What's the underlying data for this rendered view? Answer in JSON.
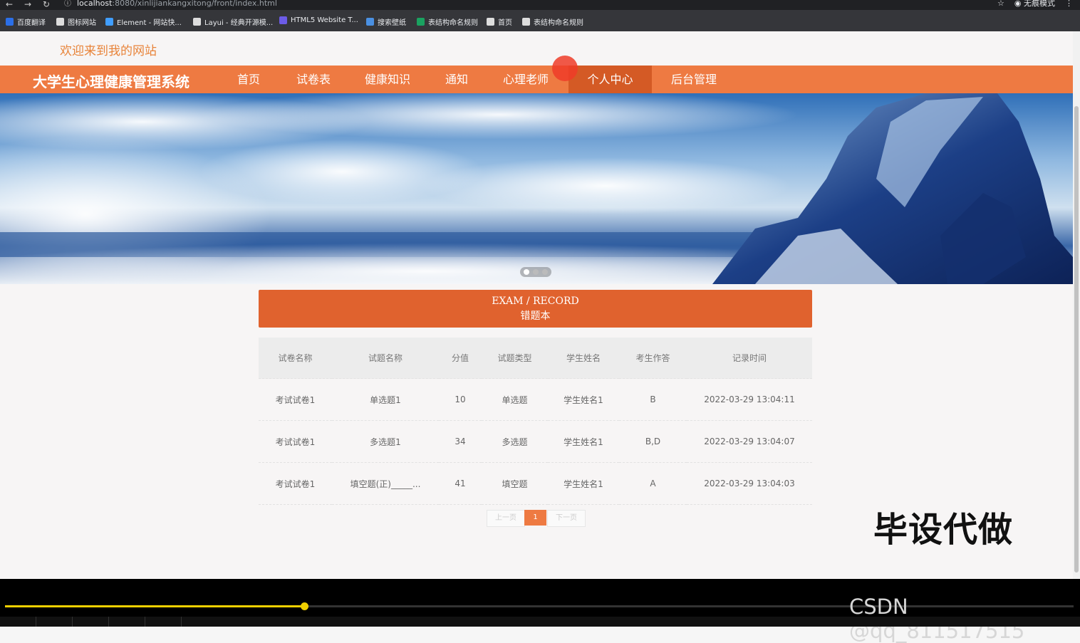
{
  "browser": {
    "url_host": "localhost",
    "url_rest": ":8080/xinlijiankangxitong/front/index.html",
    "profile_label": "无痕模式",
    "bookmarks": [
      {
        "label": "百度翻译",
        "color": "#2b6fe8"
      },
      {
        "label": "图标网站",
        "color": "#dddddd"
      },
      {
        "label": "Element - 网站快...",
        "color": "#409eff"
      },
      {
        "label": "Layui - 经典开源模...",
        "color": "#dddddd"
      },
      {
        "label": "HTML5 Website T...",
        "color": "#6c5ce7"
      },
      {
        "label": "搜索壁纸",
        "color": "#4a90e2"
      },
      {
        "label": "表结构命名规则",
        "color": "#1aa260"
      },
      {
        "label": "首页",
        "color": "#dddddd"
      },
      {
        "label": "表结构命名规则",
        "color": "#dddddd"
      }
    ]
  },
  "site": {
    "welcome": "欢迎来到我的网站",
    "system_title": "大学生心理健康管理系统",
    "nav": [
      {
        "label": "首页",
        "active": false
      },
      {
        "label": "试卷表",
        "active": false
      },
      {
        "label": "健康知识",
        "active": false
      },
      {
        "label": "通知",
        "active": false
      },
      {
        "label": "心理老师",
        "active": false
      },
      {
        "label": "个人中心",
        "active": true
      },
      {
        "label": "后台管理",
        "active": false
      }
    ],
    "accent": "#ee7a42"
  },
  "section": {
    "title_en": "EXAM / RECORD",
    "title_cn": "错题本"
  },
  "table": {
    "headers": [
      "试卷名称",
      "试题名称",
      "分值",
      "试题类型",
      "学生姓名",
      "考生作答",
      "记录时间"
    ],
    "rows": [
      [
        "考试试卷1",
        "单选题1",
        "10",
        "单选题",
        "学生姓名1",
        "B",
        "2022-03-29 13:04:11"
      ],
      [
        "考试试卷1",
        "多选题1",
        "34",
        "多选题",
        "学生姓名1",
        "B,D",
        "2022-03-29 13:04:07"
      ],
      [
        "考试试卷1",
        "填空题(正)_____...",
        "41",
        "填空题",
        "学生姓名1",
        "A",
        "2022-03-29 13:04:03"
      ]
    ]
  },
  "pagination": {
    "prev": "上一页",
    "current": "1",
    "next": "下一页"
  },
  "overlay": {
    "watermark_text": "毕设代做",
    "csdn_text": "CSDN @qq_811517515",
    "video_progress": 0.28
  }
}
